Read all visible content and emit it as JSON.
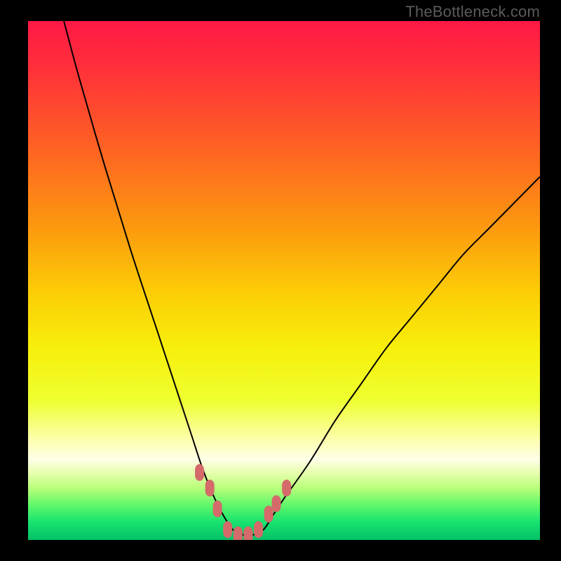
{
  "watermark": "TheBottleneck.com",
  "colors": {
    "frame": "#000000",
    "curve": "#000000",
    "marker": "#d46a6a",
    "marker_stroke": "#d46a6a",
    "gradient_stops": [
      {
        "offset": 0.0,
        "color": "#ff1846"
      },
      {
        "offset": 0.1,
        "color": "#ff3338"
      },
      {
        "offset": 0.25,
        "color": "#fe6422"
      },
      {
        "offset": 0.4,
        "color": "#fc9a0e"
      },
      {
        "offset": 0.52,
        "color": "#fccc06"
      },
      {
        "offset": 0.63,
        "color": "#f7ef0b"
      },
      {
        "offset": 0.73,
        "color": "#eeff2f"
      },
      {
        "offset": 0.8,
        "color": "#fbffa2"
      },
      {
        "offset": 0.845,
        "color": "#ffffe8"
      },
      {
        "offset": 0.87,
        "color": "#e7ffae"
      },
      {
        "offset": 0.9,
        "color": "#b8ff7a"
      },
      {
        "offset": 0.935,
        "color": "#5bf66a"
      },
      {
        "offset": 0.965,
        "color": "#19e36f"
      },
      {
        "offset": 1.0,
        "color": "#04c167"
      }
    ]
  },
  "chart_data": {
    "type": "line",
    "title": "",
    "xlabel": "",
    "ylabel": "",
    "xlim": [
      0,
      100
    ],
    "ylim": [
      0,
      100
    ],
    "grid": false,
    "legend": false,
    "note": "Vertical gradient background from red (top, high mismatch) to green (bottom, balanced). Black curve shows mismatch %, reaching ~0 near x≈39–46. Pink rounded markers highlight the near-zero region.",
    "series": [
      {
        "name": "curve",
        "x": [
          7,
          10,
          15,
          20,
          25,
          28,
          30,
          32,
          34,
          36,
          38,
          40,
          42,
          44,
          46,
          48,
          50,
          55,
          60,
          65,
          70,
          75,
          80,
          85,
          90,
          95,
          100
        ],
        "y": [
          100,
          89,
          72,
          56,
          41,
          32,
          26,
          20,
          14,
          9,
          5,
          2,
          1,
          1,
          2,
          5,
          8,
          15,
          23,
          30,
          37,
          43,
          49,
          55,
          60,
          65,
          70
        ]
      }
    ],
    "markers": {
      "name": "selected-range",
      "x": [
        33.5,
        35.5,
        37,
        39,
        41,
        43,
        45,
        47,
        48.5,
        50.5
      ],
      "y": [
        13,
        10,
        6,
        2,
        1,
        1,
        2,
        5,
        7,
        10
      ],
      "style": "rounded-pink"
    }
  }
}
